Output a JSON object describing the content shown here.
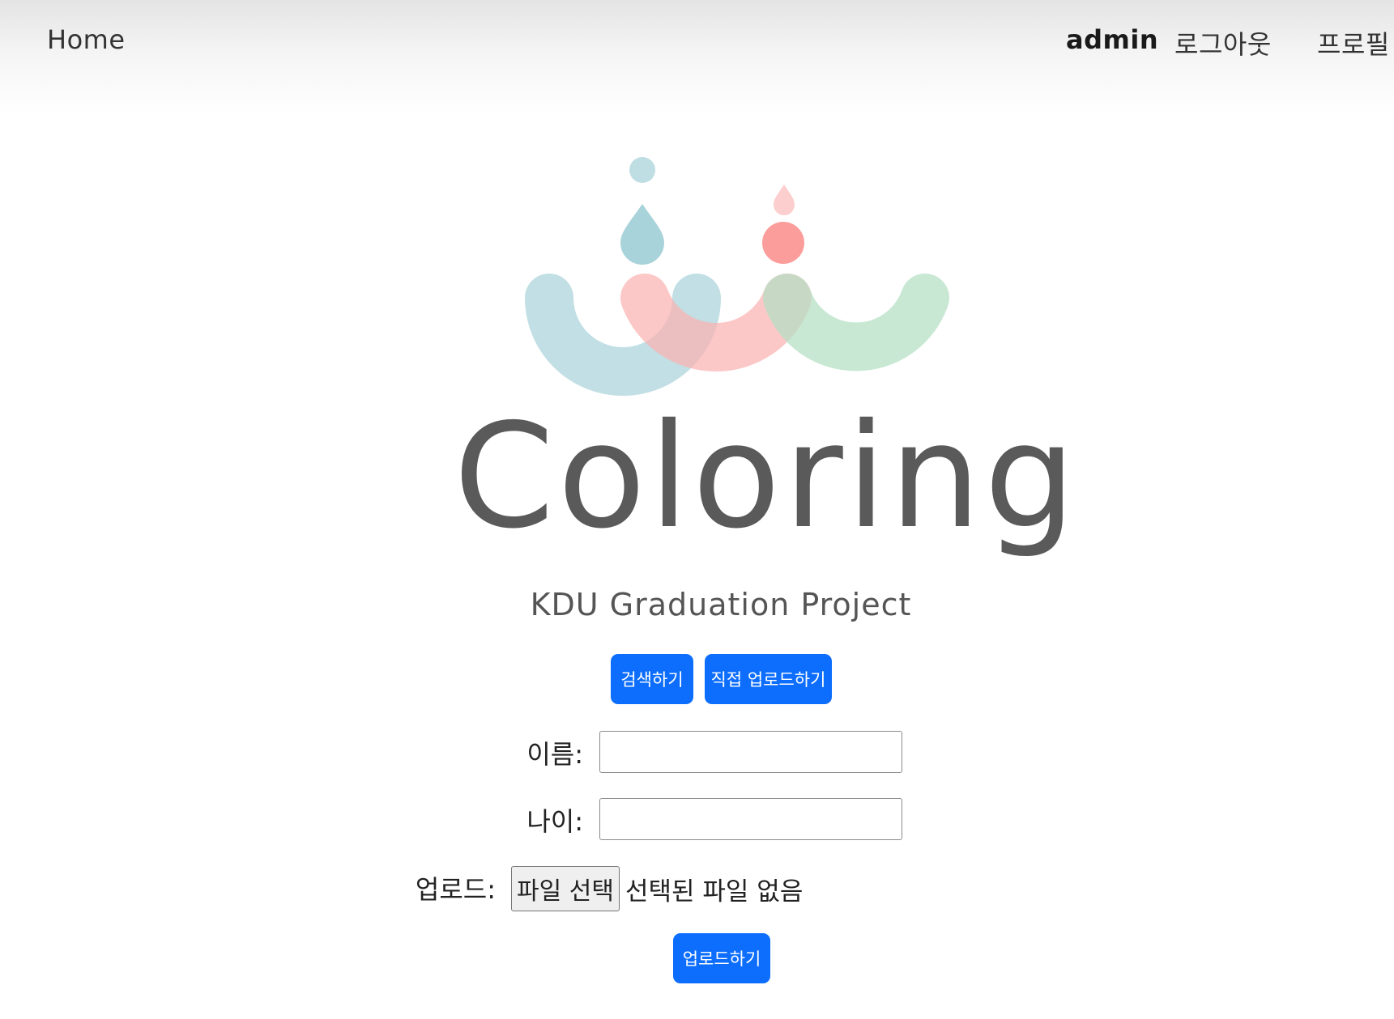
{
  "nav": {
    "home": "Home",
    "username": "admin",
    "logout": "로그아웃",
    "profile": "프로필"
  },
  "logo": {
    "wordmark": "Coloring",
    "subtitle": "KDU Graduation Project",
    "colors": {
      "blue": "#a9d3da",
      "pink": "#fbb3b1",
      "green": "#b3dfc3",
      "text": "#5a5a5a"
    }
  },
  "actions": {
    "search_label": "검색하기",
    "direct_upload_label": "직접 업로드하기"
  },
  "form": {
    "name_label": "이름:",
    "name_value": "",
    "age_label": "나이:",
    "age_value": "",
    "upload_label": "업로드:",
    "file_button_label": "파일 선택",
    "file_status": "선택된 파일 없음",
    "submit_label": "업로드하기"
  },
  "theme": {
    "primary": "#0d6efd"
  }
}
